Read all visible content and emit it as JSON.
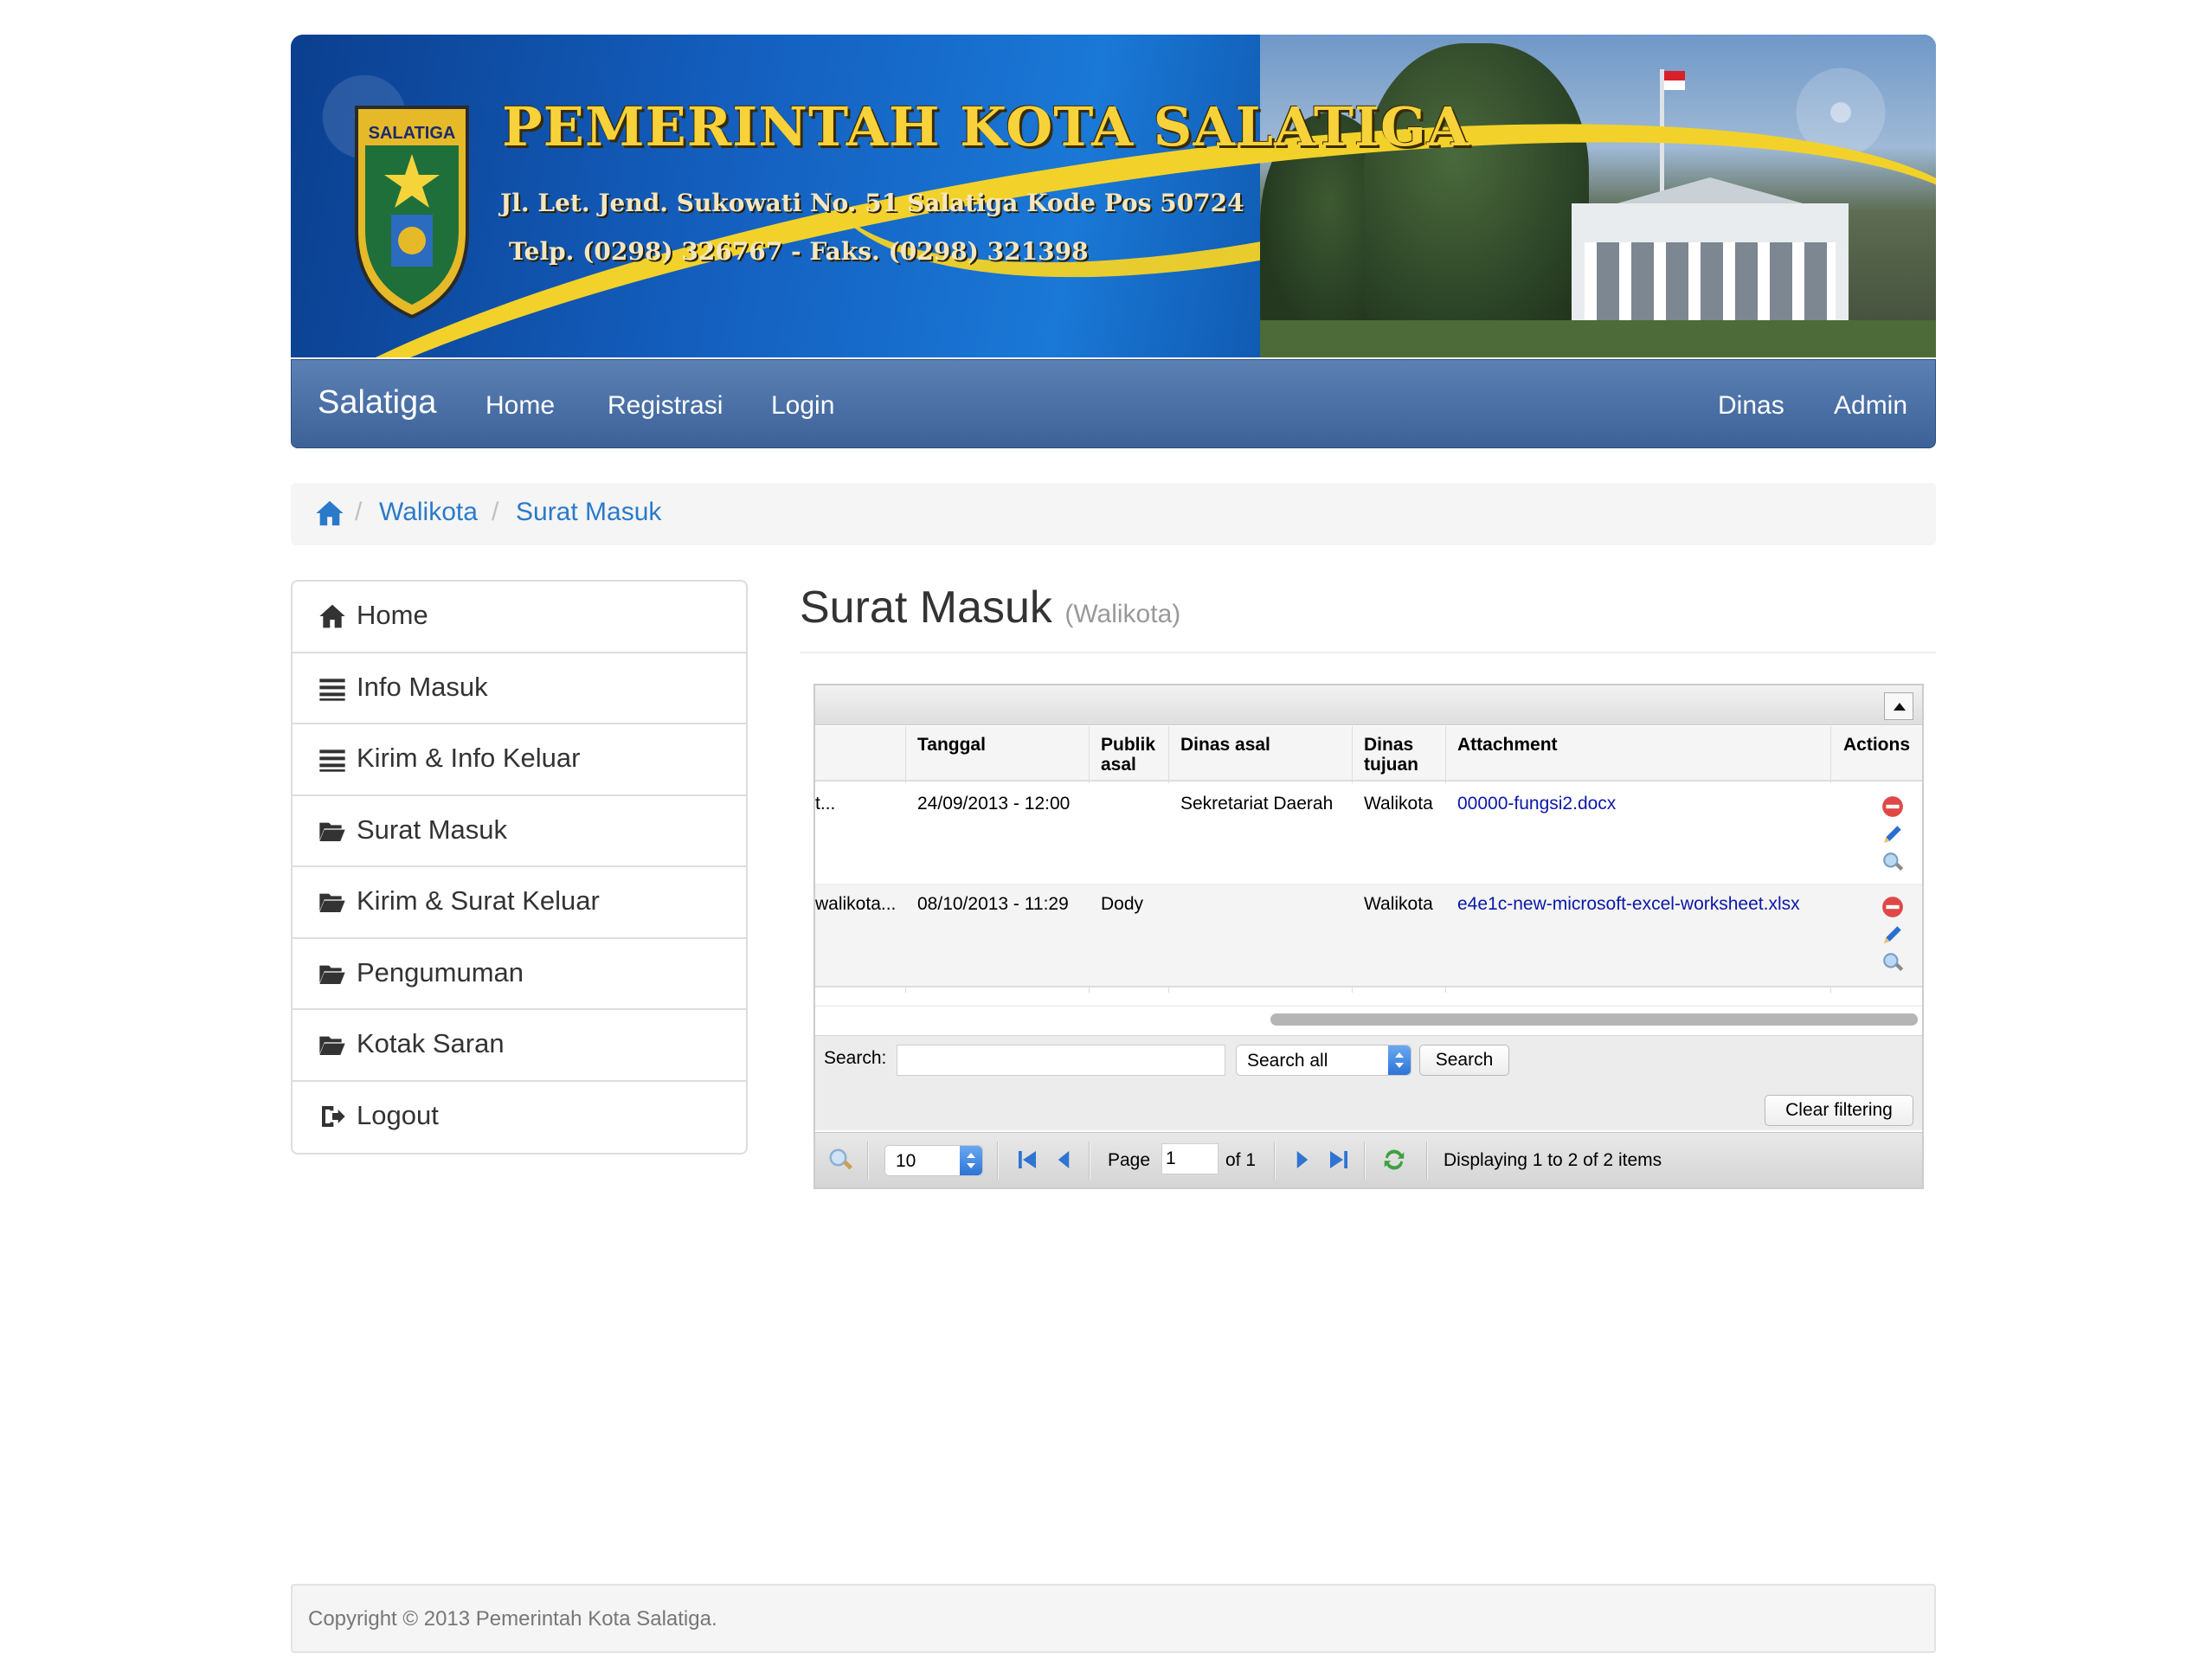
{
  "banner": {
    "title": "PEMERINTAH KOTA SALATIGA",
    "address": "Jl. Let. Jend. Sukowati No. 51 Salatiga Kode Pos 50724",
    "phone": "Telp. (0298) 326767 - Faks. (0298) 321398",
    "crest_label": "SALATIGA"
  },
  "navbar": {
    "brand": "Salatiga",
    "left_items": [
      "Home",
      "Registrasi",
      "Login"
    ],
    "right_items": [
      "Dinas",
      "Admin"
    ]
  },
  "breadcrumb": {
    "home_icon": "home-icon",
    "items": [
      "Walikota",
      "Surat Masuk"
    ]
  },
  "sidebar": {
    "items": [
      {
        "label": "Home",
        "icon": "home-icon"
      },
      {
        "label": "Info Masuk",
        "icon": "list-icon"
      },
      {
        "label": "Kirim & Info Keluar",
        "icon": "list-icon"
      },
      {
        "label": "Surat Masuk",
        "icon": "folder-open-icon"
      },
      {
        "label": "Kirim & Surat Keluar",
        "icon": "folder-open-icon"
      },
      {
        "label": "Pengumuman",
        "icon": "folder-open-icon"
      },
      {
        "label": "Kotak Saran",
        "icon": "folder-open-icon"
      },
      {
        "label": "Logout",
        "icon": "logout-icon"
      }
    ]
  },
  "page": {
    "title": "Surat Masuk",
    "subtitle": "(Walikota)"
  },
  "grid": {
    "columns": {
      "tanggal": "Tanggal",
      "publik_1": "Publik",
      "publik_2": "asal",
      "dinas_asal": "Dinas asal",
      "dinas_tujuan_1": "Dinas",
      "dinas_tujuan_2": "tujuan",
      "attachment": "Attachment",
      "actions": "Actions"
    },
    "rows": [
      {
        "cut": "t...",
        "tanggal": "24/09/2013 - 12:00",
        "publik_asal": "",
        "dinas_asal": "Sekretariat Daerah",
        "dinas_tujuan": "Walikota",
        "attachment": "00000-fungsi2.docx"
      },
      {
        "cut": "walikota...",
        "tanggal": "08/10/2013 - 11:29",
        "publik_asal": "Dody",
        "dinas_asal": "",
        "dinas_tujuan": "Walikota",
        "attachment": "e4e1c-new-microsoft-excel-worksheet.xlsx"
      }
    ],
    "action_icons": [
      "delete-icon",
      "edit-icon",
      "view-icon"
    ],
    "search": {
      "label": "Search:",
      "value": "",
      "scope": "Search all",
      "button": "Search",
      "clear_button": "Clear filtering"
    },
    "pager": {
      "page_size": "10",
      "page_label": "Page",
      "page_value": "1",
      "of_label": "of 1",
      "status": "Displaying 1 to 2 of 2 items"
    }
  },
  "footer": {
    "text": "Copyright © 2013 Pemerintah Kota Salatiga."
  }
}
